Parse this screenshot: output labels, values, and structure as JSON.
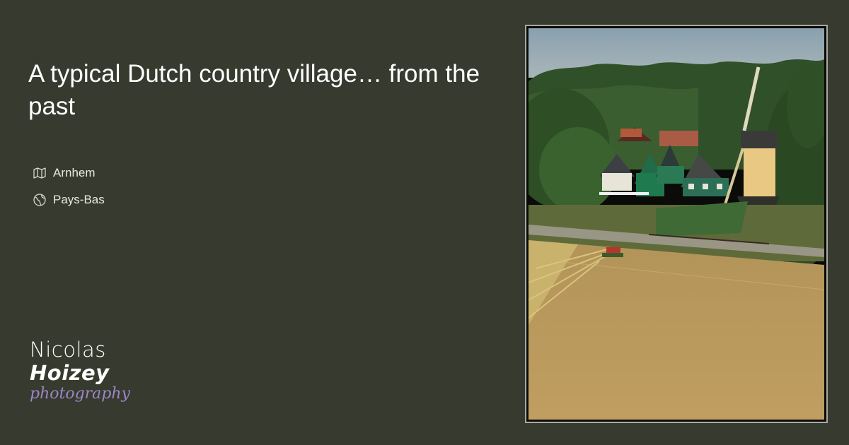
{
  "post": {
    "title": "A typical Dutch country village… from the past",
    "city": "Arnhem",
    "country": "Pays-Bas",
    "city_icon": "map-icon",
    "country_icon": "globe-icon"
  },
  "brand": {
    "line1": "Nicolas",
    "line2": "Hoizey",
    "line3": "photography"
  },
  "colors": {
    "background": "#373a2e",
    "text": "#ffffff",
    "brand_accent": "#9c86c7"
  }
}
